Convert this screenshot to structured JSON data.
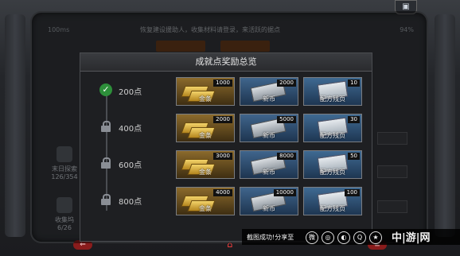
{
  "status": {
    "time": "100ms",
    "battery": "94%"
  },
  "background": {
    "notice": "恢复建设援助人，收集材料请登录，来活跃的据点",
    "tabs": [
      "",
      ""
    ],
    "side_items": [
      {
        "label": "末日探索",
        "count": "126/354"
      },
      {
        "label": "收集坞",
        "count": "6/26"
      }
    ]
  },
  "modal": {
    "title": "成就点奖励总览",
    "rows": [
      {
        "points": "200点",
        "state": "claimed",
        "gold": "1000",
        "cash": "2000",
        "blueprint": "10"
      },
      {
        "points": "400点",
        "state": "locked",
        "gold": "2000",
        "cash": "5000",
        "blueprint": "30"
      },
      {
        "points": "600点",
        "state": "locked",
        "gold": "3000",
        "cash": "8000",
        "blueprint": "50"
      },
      {
        "points": "800点",
        "state": "locked",
        "gold": "4000",
        "cash": "10000",
        "blueprint": "100"
      }
    ],
    "reward_names": {
      "gold": "金条",
      "cash": "新币",
      "blueprint": "配方残页"
    }
  },
  "share_bar": {
    "label": "截图成功!分享至"
  },
  "watermark": "中|游|网",
  "icons": {
    "check": "check-icon",
    "lock": "lock-icon",
    "weibo": "weibo-icon",
    "wechat": "wechat-icon",
    "moments": "moments-icon",
    "qq": "qq-icon",
    "qzone": "qzone-icon"
  },
  "colors": {
    "accent": "#2d8f3a",
    "gold_panel": "#8b6a2c",
    "blue_panel": "#40658c"
  }
}
